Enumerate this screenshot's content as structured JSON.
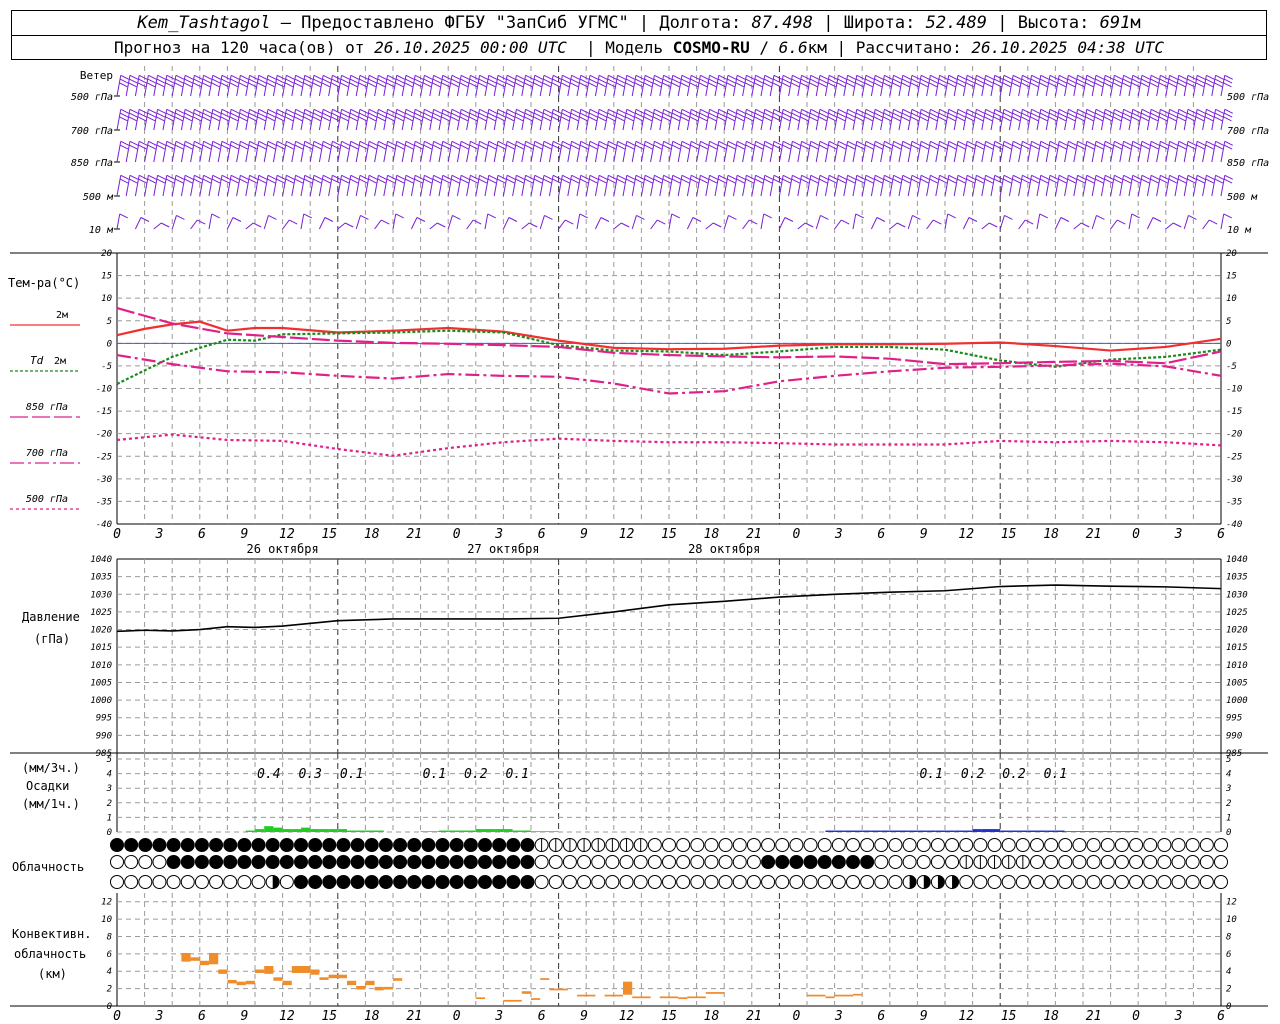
{
  "header": {
    "station": "Kem_Tashtagol",
    "provided_by": "Предоставлено ФГБУ \"ЗапСиб УГМС\"",
    "lon_label": "Долгота:",
    "lon_value": "87.498",
    "lat_label": "Широта:",
    "lat_value": "52.489",
    "alt_label": "Высота:",
    "alt_value": "691",
    "alt_unit": "м",
    "forecast_prefix": "Прогноз на 120 часа(ов) от",
    "forecast_time": "26.10.2025 00:00 UTC",
    "model_label": "Модель",
    "model_name": "COSMO-RU",
    "model_res": "6.6",
    "model_res_unit": "км",
    "calc_label": "Рассчитано:",
    "calc_time": "26.10.2025 04:38 UTC"
  },
  "colors": {
    "wind": "#7a1fd6",
    "t2m": "#f03030",
    "td2m": "#1a8a1a",
    "t850": "#e0208a",
    "t700": "#e0208a",
    "t500": "#e0208a",
    "zero_line": "#3b5bd9",
    "precip_green": "#22cc22",
    "precip_blue": "#2233cc",
    "conv": "#f08c2a",
    "grid": "#9a9a9a"
  },
  "time_axis": {
    "hour_ticks": [
      "0",
      "3",
      "6",
      "9",
      "12",
      "15",
      "18",
      "21",
      "0",
      "3",
      "6",
      "9",
      "12",
      "15",
      "18",
      "21",
      "0",
      "3",
      "6",
      "9",
      "12",
      "15",
      "18",
      "21",
      "0",
      "3",
      "6"
    ],
    "days": [
      "26 октября",
      "27 октября",
      "28 октября"
    ]
  },
  "wind": {
    "title": "Ветер",
    "levels": [
      "500 гПа",
      "700 гПа",
      "850 гПа",
      "500 м",
      "10  м"
    ]
  },
  "temperature": {
    "title": "Тем-ра(°С)",
    "yticks": [
      "20",
      "15",
      "10",
      "5",
      "0",
      "-5",
      "-10",
      "-15",
      "-20",
      "-25",
      "-30",
      "-35",
      "-40"
    ],
    "legend": [
      {
        "label": "2м",
        "key": "t2m"
      },
      {
        "label_italic": "Td",
        "label": "2м",
        "key": "td2m"
      },
      {
        "label": "850 гПа",
        "key": "t850"
      },
      {
        "label": "700 гПа",
        "key": "t700"
      },
      {
        "label": "500 гПа",
        "key": "t500"
      }
    ]
  },
  "pressure": {
    "title": "Давление",
    "unit": "(гПа)",
    "yticks": [
      "1040",
      "1035",
      "1030",
      "1025",
      "1020",
      "1015",
      "1010",
      "1005",
      "1000",
      "995",
      "990",
      "985"
    ]
  },
  "precipitation": {
    "title_top": "(мм/3ч.)",
    "title": "Осадки",
    "title_bottom": "(мм/1ч.)",
    "yticks": [
      "5",
      "4",
      "3",
      "2",
      "1",
      "0"
    ]
  },
  "cloudiness": {
    "title": "Облачность"
  },
  "convective": {
    "title1": "Конвективн.",
    "title2": "облачность",
    "title3": "(км)",
    "yticks": [
      "12",
      "10",
      "8",
      "6",
      "4",
      "2",
      "0"
    ]
  },
  "chart_data": [
    {
      "type": "line",
      "name": "temperature",
      "x_unit": "hours from 26.10.2025 00:00 UTC",
      "ylim": [
        -40,
        20
      ],
      "series": [
        {
          "name": "2м",
          "x": [
            0,
            3,
            6,
            9,
            12,
            15,
            18,
            24,
            30,
            36,
            42,
            48,
            54,
            60,
            66,
            72,
            78,
            84,
            90,
            96,
            102,
            108,
            114,
            120
          ],
          "values": [
            1.8,
            3.2,
            4.2,
            4.8,
            2.8,
            3.4,
            3.4,
            2.4,
            2.8,
            3.4,
            2.6,
            0.6,
            -1,
            -1.3,
            -1.2,
            -0.5,
            -0.2,
            -0.2,
            -0.1,
            0.2,
            -0.6,
            -1.6,
            -0.8,
            1
          ]
        },
        {
          "name": "Td 2м",
          "x": [
            0,
            3,
            6,
            9,
            12,
            15,
            18,
            24,
            30,
            36,
            42,
            48,
            54,
            60,
            66,
            72,
            78,
            84,
            90,
            96,
            102,
            108,
            114,
            120
          ],
          "values": [
            -9,
            -6,
            -3,
            -1,
            0.8,
            0.6,
            2,
            2.2,
            2.4,
            2.8,
            2.4,
            -0.4,
            -1.6,
            -1.8,
            -2.6,
            -1.8,
            -0.8,
            -0.8,
            -1.4,
            -3.8,
            -5.2,
            -3.6,
            -3,
            -1.4
          ]
        },
        {
          "name": "850 гПа",
          "x": [
            0,
            6,
            12,
            18,
            24,
            30,
            36,
            42,
            48,
            54,
            60,
            66,
            72,
            78,
            84,
            90,
            96,
            102,
            108,
            114,
            120
          ],
          "values": [
            7.8,
            4.4,
            2.2,
            1.4,
            0.6,
            0.1,
            -0.1,
            -0.4,
            -0.8,
            -2.1,
            -2.6,
            -2.9,
            -3.1,
            -2.9,
            -3.4,
            -4.6,
            -4.4,
            -4.1,
            -3.9,
            -4.4,
            -1.8
          ]
        },
        {
          "name": "700 гПа",
          "x": [
            0,
            6,
            12,
            18,
            24,
            30,
            36,
            42,
            48,
            54,
            60,
            66,
            72,
            78,
            84,
            90,
            96,
            102,
            108,
            114,
            120
          ],
          "values": [
            -2.6,
            -4.6,
            -6.2,
            -6.4,
            -7.2,
            -7.8,
            -6.8,
            -7.2,
            -7.4,
            -8.9,
            -11.1,
            -10.6,
            -8.4,
            -7.2,
            -6.2,
            -5.4,
            -5.2,
            -4.9,
            -4.5,
            -5.1,
            -7.2
          ]
        },
        {
          "name": "500 гПа",
          "x": [
            0,
            6,
            12,
            18,
            24,
            30,
            36,
            42,
            48,
            54,
            60,
            66,
            72,
            78,
            84,
            90,
            96,
            102,
            108,
            114,
            120
          ],
          "values": [
            -21.4,
            -20.2,
            -21.4,
            -21.6,
            -23.4,
            -24.9,
            -23.2,
            -21.9,
            -21.1,
            -21.6,
            -21.9,
            -21.9,
            -22.1,
            -22.4,
            -22.4,
            -22.4,
            -21.6,
            -21.9,
            -21.6,
            -21.9,
            -22.6
          ]
        }
      ]
    },
    {
      "type": "line",
      "name": "pressure",
      "ylim": [
        985,
        1040
      ],
      "x": [
        0,
        3,
        6,
        9,
        12,
        15,
        18,
        24,
        30,
        36,
        42,
        48,
        54,
        60,
        66,
        72,
        78,
        84,
        90,
        96,
        102,
        108,
        114,
        120
      ],
      "values": [
        1019.5,
        1019.8,
        1019.6,
        1020,
        1020.8,
        1020.6,
        1021,
        1022.5,
        1023,
        1023,
        1023,
        1023.2,
        1025,
        1027,
        1028,
        1029.2,
        1030,
        1030.6,
        1031,
        1032.2,
        1032.6,
        1032.3,
        1032.1,
        1031.6
      ]
    },
    {
      "type": "bar",
      "name": "precipitation",
      "ylim": [
        0,
        5
      ],
      "labels_3h": [
        {
          "x": 16.5,
          "text": "0.4"
        },
        {
          "x": 21,
          "text": "0.3"
        },
        {
          "x": 25.5,
          "text": "0.1"
        },
        {
          "x": 34.5,
          "text": "0.1"
        },
        {
          "x": 39,
          "text": "0.2"
        },
        {
          "x": 43.5,
          "text": "0.1"
        },
        {
          "x": 88.5,
          "text": "0.1"
        },
        {
          "x": 93,
          "text": "0.2"
        },
        {
          "x": 97.5,
          "text": "0.2"
        },
        {
          "x": 102,
          "text": "0.1"
        }
      ],
      "x": [
        14,
        15,
        16,
        17,
        18,
        19,
        20,
        21,
        22,
        23,
        24,
        25,
        26,
        27,
        28,
        33,
        34,
        35,
        36,
        37,
        38,
        39,
        40,
        41,
        42,
        43,
        44,
        45,
        46,
        47,
        77,
        78,
        79,
        80,
        81,
        82,
        83,
        84,
        85,
        86,
        87,
        88,
        89,
        90,
        91,
        92,
        93,
        94,
        95,
        96,
        97,
        98,
        99,
        100,
        101,
        102,
        103,
        104,
        105,
        106,
        107,
        108,
        109,
        110
      ],
      "values": [
        0.1,
        0.2,
        0.4,
        0.3,
        0.2,
        0.2,
        0.3,
        0.2,
        0.2,
        0.2,
        0.2,
        0.1,
        0.1,
        0.1,
        0.1,
        0.05,
        0.05,
        0.1,
        0.1,
        0.1,
        0.1,
        0.2,
        0.2,
        0.2,
        0.2,
        0.1,
        0.1,
        0.05,
        0.05,
        0.05,
        0.1,
        0.1,
        0.1,
        0.1,
        0.1,
        0.1,
        0.1,
        0.1,
        0.1,
        0.1,
        0.1,
        0.1,
        0.1,
        0.1,
        0.1,
        0.1,
        0.2,
        0.2,
        0.2,
        0.1,
        0.1,
        0.1,
        0.1,
        0.1,
        0.1,
        0.1,
        0.05,
        0.05,
        0.05,
        0.05,
        0.05,
        0.05,
        0.05,
        0.05
      ],
      "colors_by_range": [
        {
          "from": 14,
          "to": 47,
          "color": "precip_green"
        },
        {
          "from": 77,
          "to": 110,
          "color": "precip_blue"
        }
      ]
    },
    {
      "type": "bar",
      "name": "convective_cloud",
      "ylim": [
        0,
        13
      ],
      "bars": [
        {
          "x0": 7,
          "x1": 8,
          "bottom": 5.1,
          "top": 6.1
        },
        {
          "x0": 8,
          "x1": 9,
          "bottom": 5.2,
          "top": 5.6
        },
        {
          "x0": 9,
          "x1": 10,
          "bottom": 4.7,
          "top": 5.2
        },
        {
          "x0": 10,
          "x1": 11,
          "bottom": 4.8,
          "top": 6.1
        },
        {
          "x0": 11,
          "x1": 12,
          "bottom": 3.7,
          "top": 4.2
        },
        {
          "x0": 12,
          "x1": 13,
          "bottom": 2.6,
          "top": 3.0
        },
        {
          "x0": 13,
          "x1": 14,
          "bottom": 2.4,
          "top": 2.8
        },
        {
          "x0": 14,
          "x1": 15,
          "bottom": 2.5,
          "top": 2.9
        },
        {
          "x0": 15,
          "x1": 16,
          "bottom": 3.8,
          "top": 4.2
        },
        {
          "x0": 16,
          "x1": 17,
          "bottom": 3.7,
          "top": 4.6
        },
        {
          "x0": 17,
          "x1": 18,
          "bottom": 2.9,
          "top": 3.3
        },
        {
          "x0": 18,
          "x1": 19,
          "bottom": 2.4,
          "top": 2.9
        },
        {
          "x0": 19,
          "x1": 21,
          "bottom": 3.8,
          "top": 4.6
        },
        {
          "x0": 21,
          "x1": 22,
          "bottom": 3.6,
          "top": 4.2
        },
        {
          "x0": 22,
          "x1": 23,
          "bottom": 3.0,
          "top": 3.3
        },
        {
          "x0": 23,
          "x1": 25,
          "bottom": 3.2,
          "top": 3.6
        },
        {
          "x0": 25,
          "x1": 26,
          "bottom": 2.4,
          "top": 2.9
        },
        {
          "x0": 26,
          "x1": 27,
          "bottom": 1.9,
          "top": 2.3
        },
        {
          "x0": 27,
          "x1": 28,
          "bottom": 2.4,
          "top": 2.9
        },
        {
          "x0": 28,
          "x1": 29,
          "bottom": 1.8,
          "top": 2.2
        },
        {
          "x0": 29,
          "x1": 30,
          "bottom": 1.9,
          "top": 2.2
        },
        {
          "x0": 30,
          "x1": 31,
          "bottom": 2.9,
          "top": 3.2
        },
        {
          "x0": 39,
          "x1": 40,
          "bottom": 0.8,
          "top": 1.0
        },
        {
          "x0": 42,
          "x1": 44,
          "bottom": 0.5,
          "top": 0.7
        },
        {
          "x0": 44,
          "x1": 45,
          "bottom": 1.4,
          "top": 1.7
        },
        {
          "x0": 45,
          "x1": 46,
          "bottom": 0.7,
          "top": 0.9
        },
        {
          "x0": 46,
          "x1": 47,
          "bottom": 3.0,
          "top": 3.2
        },
        {
          "x0": 47,
          "x1": 49,
          "bottom": 1.8,
          "top": 2.0
        },
        {
          "x0": 50,
          "x1": 52,
          "bottom": 1.1,
          "top": 1.3
        },
        {
          "x0": 53,
          "x1": 55,
          "bottom": 1.1,
          "top": 1.3
        },
        {
          "x0": 55,
          "x1": 56,
          "bottom": 1.3,
          "top": 2.8
        },
        {
          "x0": 56,
          "x1": 58,
          "bottom": 0.9,
          "top": 1.1
        },
        {
          "x0": 59,
          "x1": 61,
          "bottom": 0.9,
          "top": 1.1
        },
        {
          "x0": 61,
          "x1": 62,
          "bottom": 0.8,
          "top": 1.0
        },
        {
          "x0": 62,
          "x1": 64,
          "bottom": 0.9,
          "top": 1.1
        },
        {
          "x0": 64,
          "x1": 66,
          "bottom": 1.4,
          "top": 1.6
        },
        {
          "x0": 75,
          "x1": 77,
          "bottom": 1.1,
          "top": 1.3
        },
        {
          "x0": 77,
          "x1": 78,
          "bottom": 0.9,
          "top": 1.1
        },
        {
          "x0": 78,
          "x1": 80,
          "bottom": 1.1,
          "top": 1.3
        },
        {
          "x0": 80,
          "x1": 81,
          "bottom": 1.2,
          "top": 1.4
        }
      ]
    }
  ]
}
